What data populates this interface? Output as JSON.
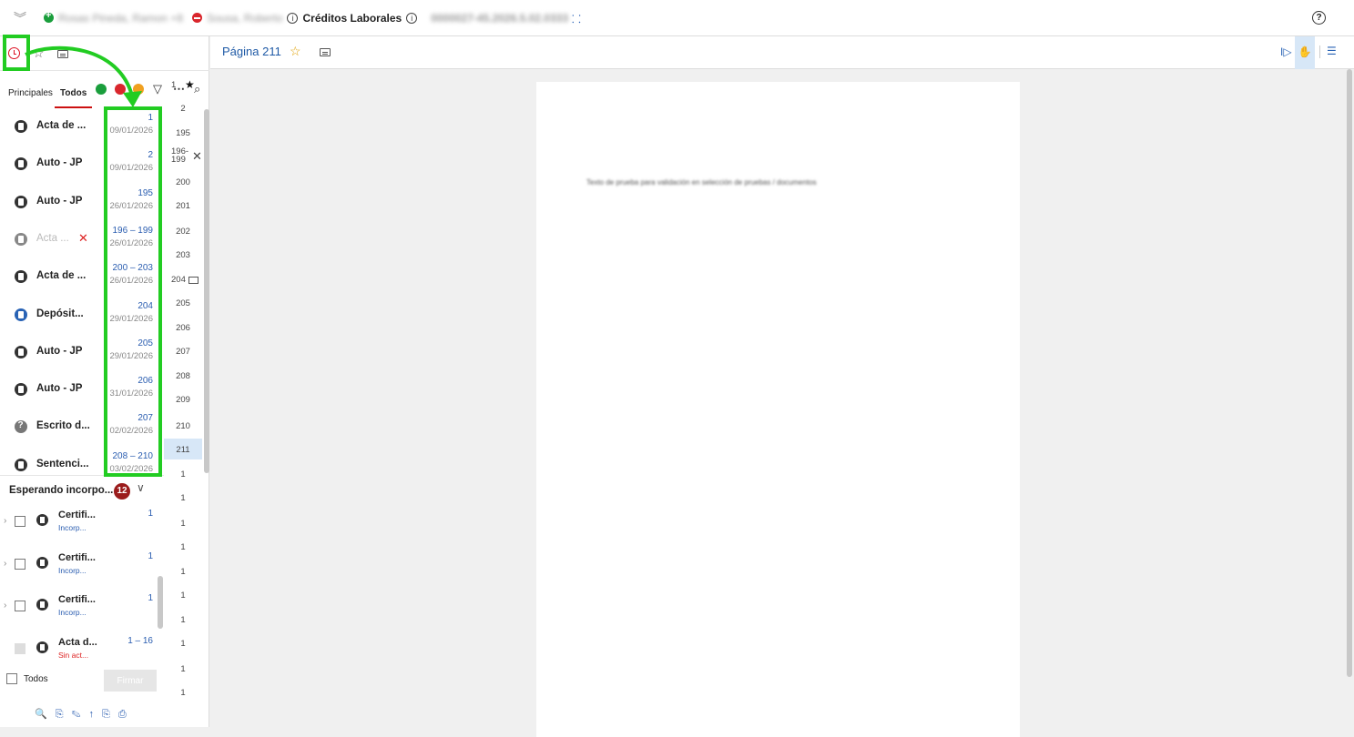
{
  "header": {
    "party_plaintiff": "Rosas Pineda, Ramon +8",
    "party_defendant": "Sousa, Roberto",
    "case_type": "Créditos Laborales",
    "case_number": "0000027-45.2026.5.02.0333"
  },
  "left_panel": {
    "tabs": [
      "Principales",
      "Todos"
    ],
    "active_tab": "Todos",
    "documents": [
      {
        "name": "Acta de ...",
        "range": "1",
        "date": "09/01/2026",
        "icon": "document-icon"
      },
      {
        "name": "Auto - JP",
        "range": "2",
        "date": "09/01/2026",
        "icon": "document-icon"
      },
      {
        "name": "Auto - JP",
        "range": "195",
        "date": "26/01/2026",
        "icon": "document-icon"
      },
      {
        "name": "Acta ...",
        "range": "196 – 199",
        "date": "26/01/2026",
        "icon": "document-icon",
        "removed": true
      },
      {
        "name": "Acta de ...",
        "range": "200 – 203",
        "date": "26/01/2026",
        "icon": "document-icon"
      },
      {
        "name": "Depósit...",
        "range": "204",
        "date": "29/01/2026",
        "icon": "deposit-icon"
      },
      {
        "name": "Auto - JP",
        "range": "205",
        "date": "29/01/2026",
        "icon": "document-icon"
      },
      {
        "name": "Auto - JP",
        "range": "206",
        "date": "31/01/2026",
        "icon": "document-icon"
      },
      {
        "name": "Escrito d...",
        "range": "207",
        "date": "02/02/2026",
        "icon": "question-icon"
      },
      {
        "name": "Sentenci...",
        "range": "208 – 210",
        "date": "03/02/2026",
        "icon": "document-icon"
      }
    ],
    "page_numbers": [
      {
        "label": "1",
        "mark": "star"
      },
      {
        "label": "2"
      },
      {
        "label": "195"
      },
      {
        "label": "196-\n199",
        "mark": "x"
      },
      {
        "label": "200"
      },
      {
        "label": "201"
      },
      {
        "label": "202"
      },
      {
        "label": "203"
      },
      {
        "label": "204",
        "mark": "comment"
      },
      {
        "label": "205"
      },
      {
        "label": "206"
      },
      {
        "label": "207"
      },
      {
        "label": "208"
      },
      {
        "label": "209"
      },
      {
        "label": "210"
      },
      {
        "label": "211",
        "active": true
      },
      {
        "label": "1"
      },
      {
        "label": "1"
      },
      {
        "label": "1"
      },
      {
        "label": "1"
      },
      {
        "label": "1"
      },
      {
        "label": "1"
      },
      {
        "label": "1"
      },
      {
        "label": "1"
      },
      {
        "label": "1"
      },
      {
        "label": "1"
      }
    ],
    "waiting": {
      "title": "Esperando incorpo...",
      "count": "12",
      "items": [
        {
          "name": "Certifi...",
          "sub": "Incorp...",
          "num": "1",
          "checkbox": "enabled"
        },
        {
          "name": "Certifi...",
          "sub": "Incorp...",
          "num": "1",
          "checkbox": "enabled"
        },
        {
          "name": "Certifi...",
          "sub": "Incorp...",
          "num": "1",
          "checkbox": "enabled"
        },
        {
          "name": "Acta d...",
          "sub": "Sin act...",
          "num": "1 – 16",
          "checkbox": "disabled",
          "sub_color": "#d22222"
        }
      ]
    },
    "select_all_label": "Todos",
    "sign_button": "Firmar"
  },
  "viewer": {
    "page_label": "Página 211",
    "page_text": "Texto de prueba para validación en selección de pruebas / documentos"
  },
  "colors": {
    "accent_blue": "#1f5aa6",
    "highlight_green": "#22cc22",
    "badge_red": "#9b1c1c",
    "tab_underline": "#cc1111"
  }
}
